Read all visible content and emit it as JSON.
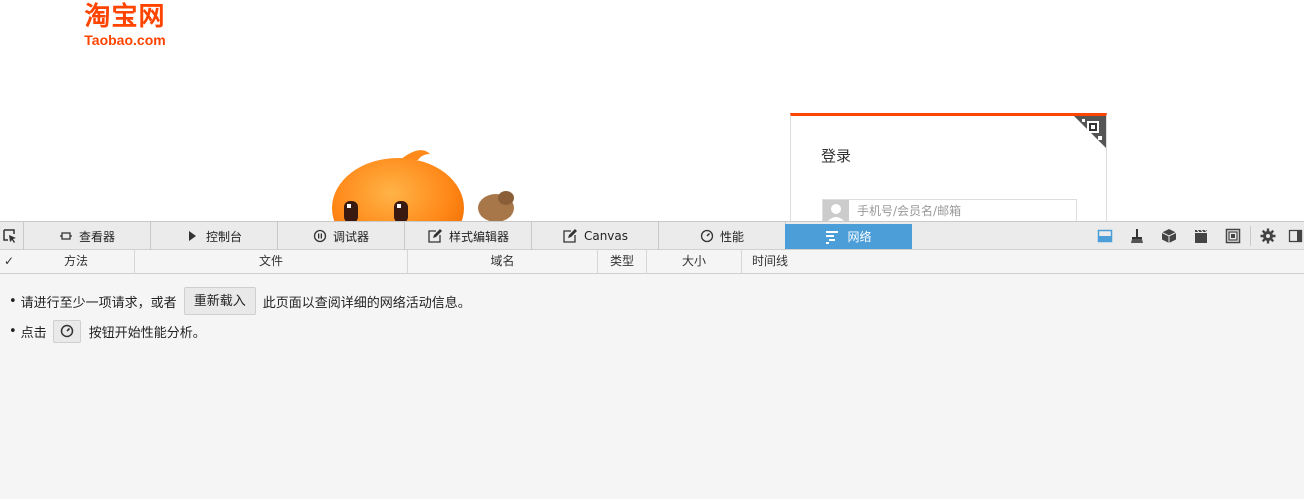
{
  "page": {
    "logo_cn": "淘宝网",
    "logo_en": "Taobao.com",
    "login": {
      "title": "登录",
      "username_placeholder": "手机号/会员名/邮箱"
    }
  },
  "devtools": {
    "tabs": [
      {
        "label": "查看器",
        "icon": "inspector-icon"
      },
      {
        "label": "控制台",
        "icon": "console-icon"
      },
      {
        "label": "调试器",
        "icon": "debugger-icon"
      },
      {
        "label": "样式编辑器",
        "icon": "style-editor-icon"
      },
      {
        "label": "Canvas",
        "icon": "canvas-icon"
      },
      {
        "label": "性能",
        "icon": "performance-icon"
      },
      {
        "label": "网络",
        "icon": "network-icon",
        "active": true
      }
    ],
    "toolbar_icons": [
      "split-console-icon",
      "paintbrush-icon",
      "3d-view-icon",
      "screenshot-icon",
      "responsive-icon",
      "settings-icon",
      "dock-side-icon"
    ],
    "columns": {
      "check": "✓",
      "method": "方法",
      "file": "文件",
      "domain": "域名",
      "type": "类型",
      "size": "大小",
      "timeline": "时间线"
    },
    "notice1": {
      "before": "请进行至少一项请求，或者",
      "button": "重新载入",
      "after": "此页面以查阅详细的网络活动信息。"
    },
    "notice2": {
      "before": "点击",
      "after": "按钮开始性能分析。"
    },
    "accent_color": "#4c9ed9",
    "brand_color": "#ff4400"
  }
}
